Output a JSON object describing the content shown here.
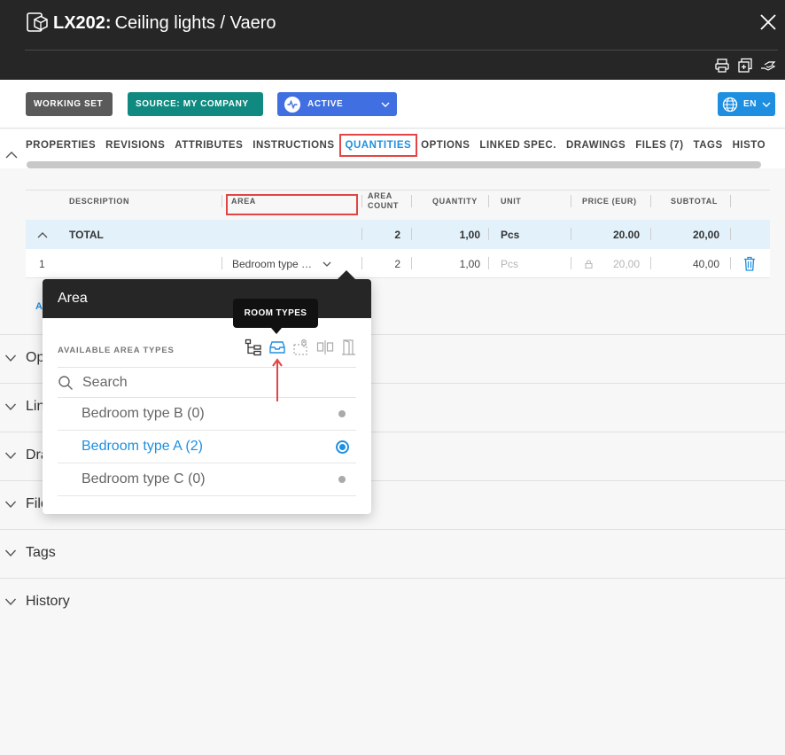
{
  "header": {
    "code": "LX202:",
    "title": "Ceiling lights / Vaero",
    "tools": [
      "print-icon",
      "add-document-icon",
      "handover-icon"
    ]
  },
  "statusbar": {
    "working_set": "WORKING SET",
    "source": "SOURCE: MY COMPANY",
    "status": "ACTIVE",
    "language": "EN"
  },
  "tabs": [
    {
      "label": "PROPERTIES"
    },
    {
      "label": "REVISIONS"
    },
    {
      "label": "ATTRIBUTES"
    },
    {
      "label": "INSTRUCTIONS"
    },
    {
      "label": "QUANTITIES",
      "selected": true
    },
    {
      "label": "OPTIONS"
    },
    {
      "label": "LINKED SPEC."
    },
    {
      "label": "DRAWINGS"
    },
    {
      "label": "FILES (7)"
    },
    {
      "label": "TAGS"
    },
    {
      "label": "HISTO"
    }
  ],
  "grid": {
    "columns": {
      "description": "DESCRIPTION",
      "area": "AREA",
      "area_count_1": "AREA",
      "area_count_2": "COUNT",
      "quantity": "QUANTITY",
      "unit": "UNIT",
      "price": "PRICE (EUR)",
      "subtotal": "SUBTOTAL"
    },
    "total": {
      "label": "TOTAL",
      "area_count": "2",
      "quantity": "1,00",
      "unit": "Pcs",
      "price": "20.00",
      "subtotal": "20,00"
    },
    "rows": [
      {
        "index": "1",
        "area": "Bedroom type …",
        "area_count": "2",
        "quantity": "1,00",
        "unit": "Pcs",
        "price": "20,00",
        "subtotal": "40,00"
      }
    ],
    "add_label": "A"
  },
  "accordion": [
    {
      "label": "Op"
    },
    {
      "label": "Lin"
    },
    {
      "label": "Dra"
    },
    {
      "label": "File"
    },
    {
      "label": "Tags"
    },
    {
      "label": "History"
    }
  ],
  "area_popover": {
    "title": "Area",
    "available_label": "AVAILABLE AREA TYPES",
    "tooltip": "ROOM TYPES",
    "search_placeholder": "Search",
    "options": [
      {
        "label": "Bedroom type B (0)",
        "selected": false
      },
      {
        "label": "Bedroom type A (2)",
        "selected": true
      },
      {
        "label": "Bedroom type C (0)",
        "selected": false
      }
    ]
  },
  "colors": {
    "accent": "#1e8fe0",
    "highlight": "#e24545",
    "header_bg": "#262626",
    "source_badge": "#108a80",
    "active_badge": "#3f6fe0"
  }
}
